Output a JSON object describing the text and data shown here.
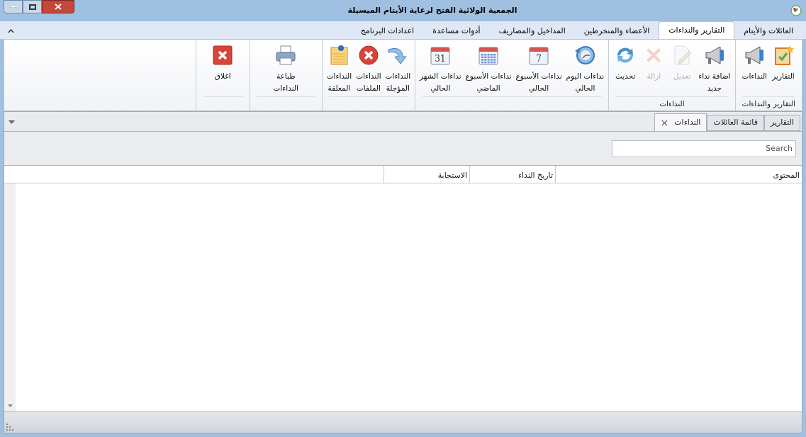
{
  "window": {
    "title": "الجمعية الولائية الفتح لرعاية الأيتام الميسيلة"
  },
  "ribbon_tabs": [
    {
      "label": "العائلات والأيتام",
      "selected": false
    },
    {
      "label": "التقارير والنداءات",
      "selected": true
    },
    {
      "label": "الأعضاء والمنخرطين",
      "selected": false
    },
    {
      "label": "المداخيل والمصاريف",
      "selected": false
    },
    {
      "label": "أدوات مساعدة",
      "selected": false
    },
    {
      "label": "اعدادات البرنامج",
      "selected": false
    }
  ],
  "ribbon_groups": [
    {
      "title": "التقارير والنداءات",
      "buttons": [
        {
          "label": "التقارير",
          "disabled": false
        },
        {
          "label": "النداءات",
          "disabled": false
        }
      ]
    },
    {
      "title": "النداءات",
      "buttons": [
        {
          "label": "اضافة نداء\nجديد",
          "disabled": false
        },
        {
          "label": "تعديل",
          "disabled": true
        },
        {
          "label": "ازالة",
          "disabled": true
        },
        {
          "label": "تحديث",
          "disabled": false
        }
      ]
    },
    {
      "buttons": [
        {
          "label": "نداءات اليوم\nالحالي",
          "disabled": false
        },
        {
          "label": "نداءات الأسبوع\nالحالي",
          "disabled": false,
          "icon_text": "7"
        },
        {
          "label": "نداءات الأسبوع\nالماضي",
          "disabled": false
        },
        {
          "label": "نداءات الشهر\nالحالي",
          "disabled": false,
          "icon_text": "31"
        }
      ]
    },
    {
      "buttons": [
        {
          "label": "النداءات\nالمؤجلة",
          "disabled": false
        },
        {
          "label": "النداءات\nالملفات",
          "disabled": false
        },
        {
          "label": "النداءات\nالمعلقة",
          "disabled": false
        }
      ]
    },
    {
      "buttons": [
        {
          "label": "طباعة\nالنداءات",
          "disabled": false
        }
      ]
    },
    {
      "buttons": [
        {
          "label": "اغلاق",
          "disabled": false
        }
      ]
    }
  ],
  "document_tabs": [
    {
      "label": "التقارير",
      "selected": false,
      "closable": false
    },
    {
      "label": "قائمة العائلات",
      "selected": false,
      "closable": false
    },
    {
      "label": "النداءات",
      "selected": true,
      "closable": true,
      "close": "×"
    }
  ],
  "search": {
    "placeholder": "Search"
  },
  "table": {
    "columns": [
      "المحتوى",
      "تاريخ النداء",
      "الاستجابة"
    ]
  }
}
